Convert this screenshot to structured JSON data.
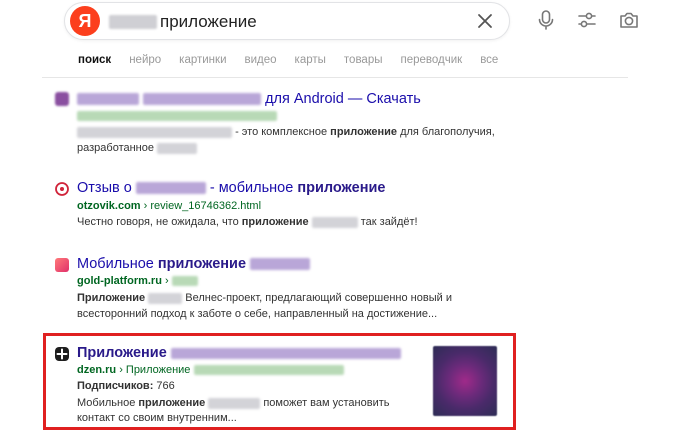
{
  "search": {
    "logo_letter": "Я",
    "query_visible": "приложение"
  },
  "tabs": [
    "поиск",
    "нейро",
    "картинки",
    "видео",
    "карты",
    "товары",
    "переводчик",
    "все"
  ],
  "results": [
    {
      "title_tail": "для Android — Скачать",
      "snippet_line1": "- это комплексное",
      "snippet_bold1": "приложение",
      "snippet_line1_end": "для благополучия,",
      "snippet_line2": "разработанное"
    },
    {
      "title_start": "Отзыв о",
      "title_mid": "- мобильное",
      "title_bold": "приложение",
      "url_domain": "otzovik.com",
      "url_path": "› review_16746362.html",
      "snippet_a": "Честно говоря, не ожидала, что",
      "snippet_bold": "приложение",
      "snippet_b": "так зайдёт!"
    },
    {
      "title_start": "Мобильное",
      "title_bold": "приложение",
      "url_domain": "gold-platform.ru",
      "url_path": "›",
      "snippet_bold": "Приложение",
      "snippet_a": "Велнес-проект, предлагающий совершенно новый и",
      "snippet_line2": "всесторонний подход к заботе о себе, направленный на достижение..."
    },
    {
      "title_bold": "Приложение",
      "url_domain": "dzen.ru",
      "url_path": "› Приложение",
      "subs_label": "Подписчиков:",
      "subs_value": "766",
      "snippet_a": "Мобильное",
      "snippet_bold": "приложение",
      "snippet_b": "поможет вам установить",
      "snippet_line2": "контакт со своим внутренним..."
    }
  ],
  "colors": {
    "logo": "#fc3f1d",
    "link": "#1a0dab",
    "url": "#006621",
    "highlight": "#e02020"
  }
}
